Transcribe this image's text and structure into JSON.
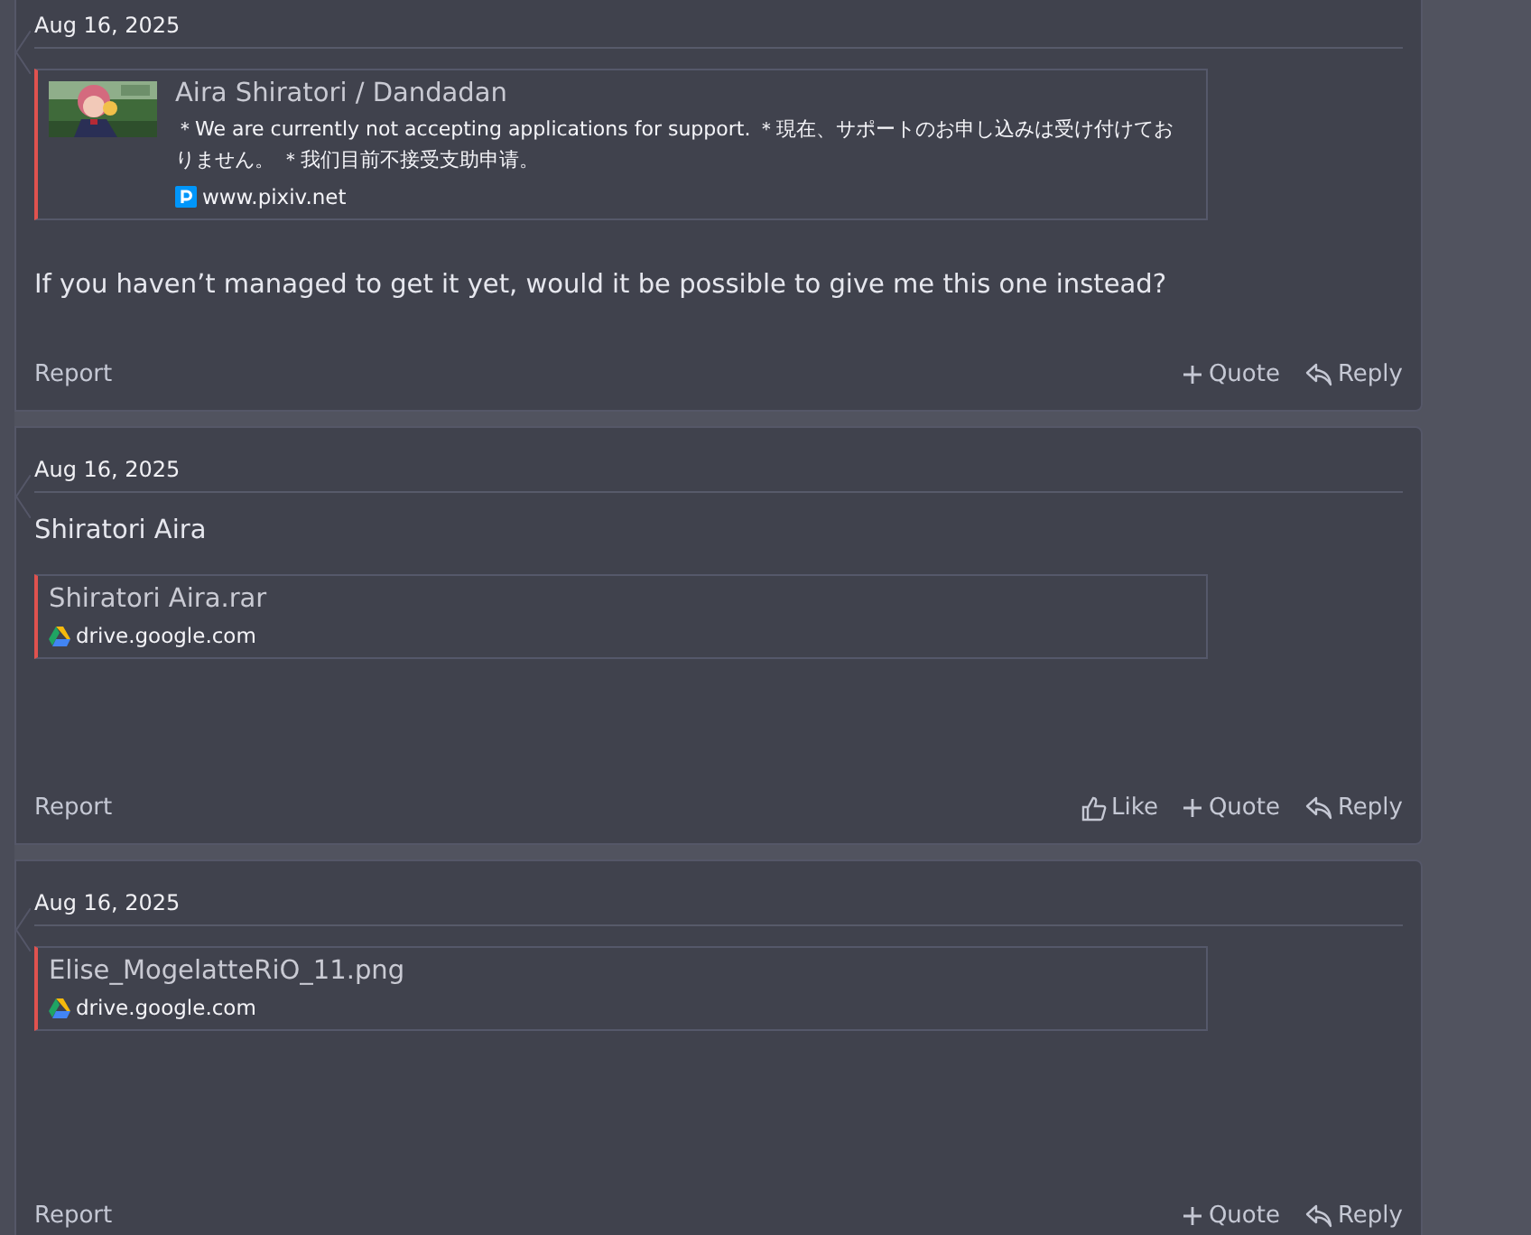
{
  "posts": [
    {
      "date": "Aug 16, 2025",
      "blocks": [
        {
          "kind": "embed",
          "favicon": {
            "kind": "pixiv"
          },
          "title": "Aira Shiratori / Dandadan",
          "description": "＊We are currently not accepting applications for support. ＊現在、サポートのお申し込みは受け付けておりません。 ＊我们目前不接受支助申请。",
          "domain": "www.pixiv.net"
        },
        {
          "kind": "text",
          "text": "If you haven’t managed to get it yet, would it be possible to give me this one instead?"
        }
      ],
      "report": "Report",
      "actions": [
        {
          "kind": "quote",
          "label": "Quote"
        },
        {
          "kind": "reply",
          "label": "Reply"
        }
      ]
    },
    {
      "date": "Aug 16, 2025",
      "blocks": [
        {
          "kind": "text",
          "text": "Shiratori Aira"
        },
        {
          "kind": "embed",
          "favicon": {
            "kind": "drive"
          },
          "title": "Shiratori Aira.rar",
          "domain": "drive.google.com"
        }
      ],
      "report": "Report",
      "actions": [
        {
          "kind": "like",
          "label": "Like"
        },
        {
          "kind": "quote",
          "label": "Quote"
        },
        {
          "kind": "reply",
          "label": "Reply"
        }
      ]
    },
    {
      "date": "Aug 16, 2025",
      "blocks": [
        {
          "kind": "embed",
          "favicon": {
            "kind": "drive"
          },
          "title": "Elise_MogelatteRiO_11.png",
          "domain": "drive.google.com"
        }
      ],
      "report": "Report",
      "actions": [
        {
          "kind": "quote",
          "label": "Quote"
        },
        {
          "kind": "reply",
          "label": "Reply"
        }
      ]
    }
  ]
}
